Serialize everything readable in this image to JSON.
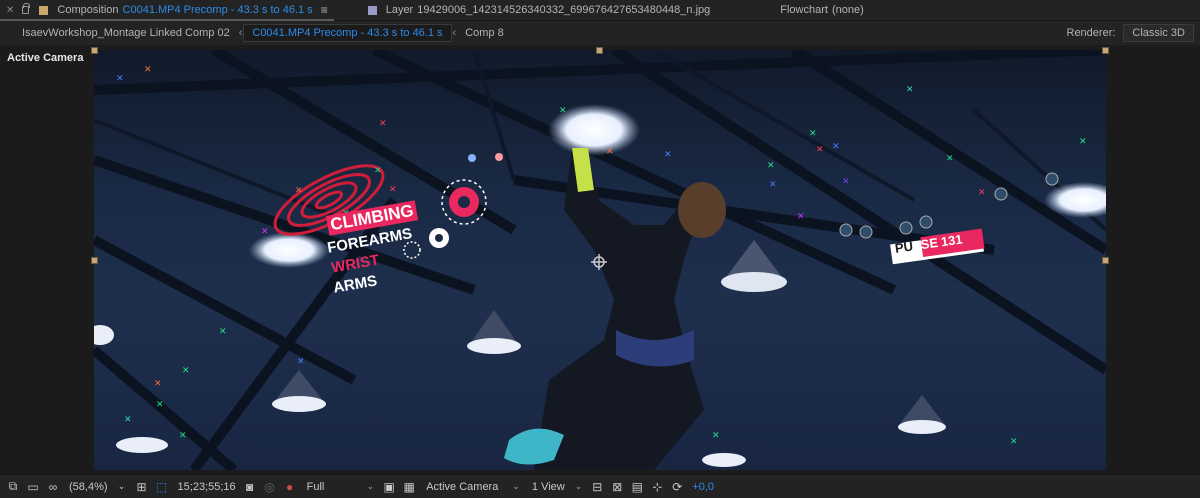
{
  "panel_tabs": [
    {
      "prefix": "Composition",
      "name": "C0041.MP4 Precomp - 43.3 s to 46.1 s",
      "menu": "≡"
    },
    {
      "prefix": "Layer",
      "name": "19429006_142314526340332_699676427653480448_n.jpg"
    },
    {
      "prefix": "Flowchart",
      "name": "(none)"
    }
  ],
  "breadcrumbs": [
    {
      "label": "IsaevWorkshop_Montage Linked Comp 02"
    },
    {
      "label": "C0041.MP4 Precomp - 43.3 s to 46.1 s"
    },
    {
      "label": "Comp 8"
    }
  ],
  "renderer": {
    "label": "Renderer:",
    "value": "Classic 3D"
  },
  "viewer": {
    "active_view_label": "Active Camera"
  },
  "overlay": {
    "l1": "CLIMBING",
    "l2": "FOREARMS",
    "l3": "WRIST",
    "l4": "ARMS",
    "pulse_a": "PU",
    "pulse_b": "LSE",
    "pulse_c": "131"
  },
  "toolbar": {
    "zoom": "(58,4%)",
    "timecode": "15;23;55;16",
    "resolution": "Full",
    "camera": "Active Camera",
    "views": "1 View",
    "exposure": "+0,0"
  },
  "colors": {
    "accent_blue": "#2d8ceb",
    "overlay_pink": "#e8285f",
    "handle": "#c7a77a"
  }
}
